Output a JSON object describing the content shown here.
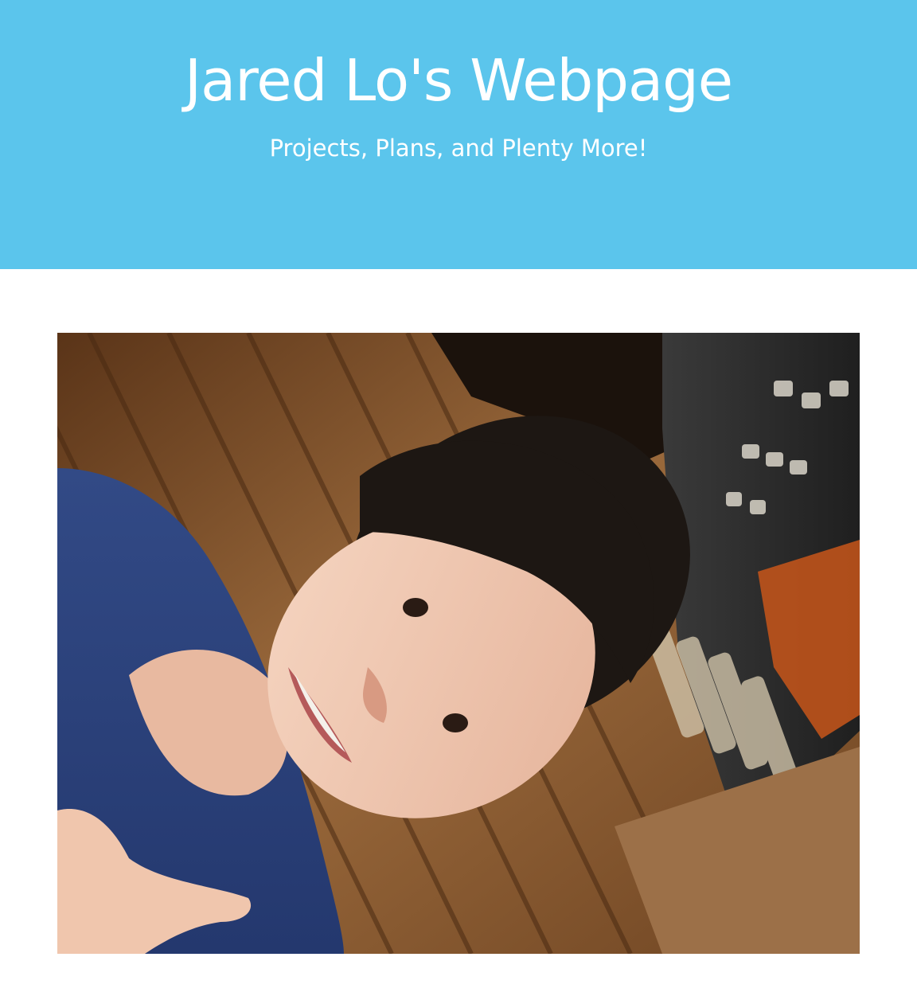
{
  "header": {
    "title": "Jared Lo's Webpage",
    "subtitle": "Projects, Plans, and Plenty More!",
    "background_color": "#5bc5ec",
    "text_color": "#ffffff"
  },
  "main": {
    "photo": {
      "kind": "profile-selfie"
    }
  }
}
